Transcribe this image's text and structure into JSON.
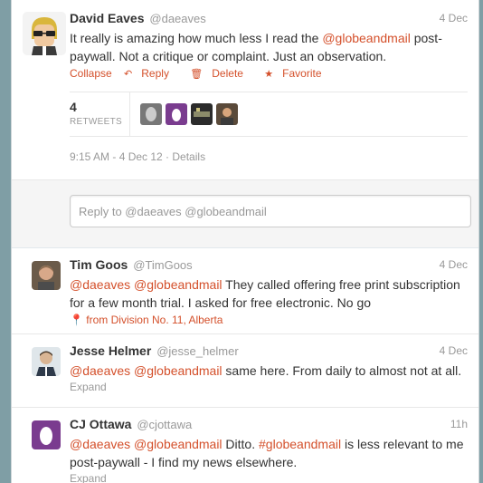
{
  "main": {
    "fullname": "David Eaves",
    "username": "@daeaves",
    "time": "4 Dec",
    "text_before": "It really is amazing how much less I read the ",
    "mention": "@globeandmail",
    "text_after": " post-paywall. Not a critique or complaint. Just an observation.",
    "actions": {
      "collapse": "Collapse",
      "reply": "Reply",
      "delete": "Delete",
      "favorite": "Favorite"
    },
    "retweet_count": "4",
    "retweets_label": "RETWEETS",
    "timestamp_line": "9:15 AM - 4 Dec 12 · Details"
  },
  "reply_box": {
    "placeholder": "Reply to @daeaves @globeandmail"
  },
  "replies": [
    {
      "fullname": "Tim Goos",
      "username": "@TimGoos",
      "time": "4 Dec",
      "mention1": "@daeaves",
      "mention2": "@globeandmail",
      "text": " They called offering free print subscription for a few month trial. I asked for free electronic. No go",
      "location": "from Division No. 11, Alberta"
    },
    {
      "fullname": "Jesse Helmer",
      "username": "@jesse_helmer",
      "time": "4 Dec",
      "mention1": "@daeaves",
      "mention2": "@globeandmail",
      "text": " same here. From daily to almost not at all.",
      "expand": "Expand"
    },
    {
      "fullname": "CJ Ottawa",
      "username": "@cjottawa",
      "time": "11h",
      "mention1": "@daeaves",
      "mention2": "@globeandmail",
      "text_mid": " Ditto. ",
      "hashtag": "#globeandmail",
      "text": " is less relevant to me post-paywall - I find my news elsewhere.",
      "expand": "Expand"
    }
  ],
  "colors": {
    "accent": "#d4502b",
    "background": "#7f9ea5"
  }
}
